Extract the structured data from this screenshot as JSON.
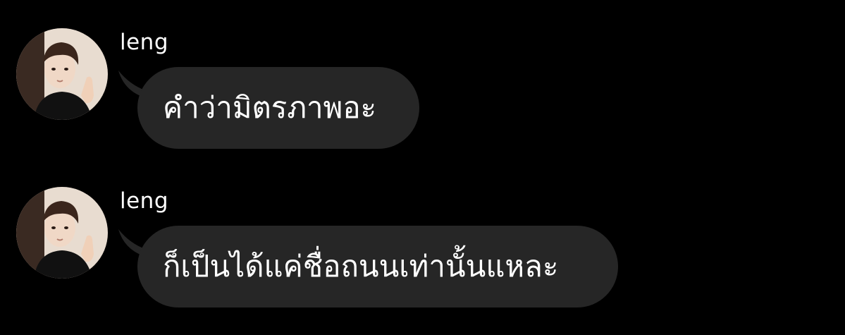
{
  "theme": {
    "background": "#000000",
    "bubble_color": "#262626",
    "text_color": "#ffffff"
  },
  "messages": [
    {
      "sender": "leng",
      "avatar_icon": "profile-photo",
      "text": "คำว่ามิตรภาพอะ"
    },
    {
      "sender": "leng",
      "avatar_icon": "profile-photo",
      "text": "ก็เป็นได้แค่ชื่อถนนเท่านั้นแหละ"
    }
  ]
}
